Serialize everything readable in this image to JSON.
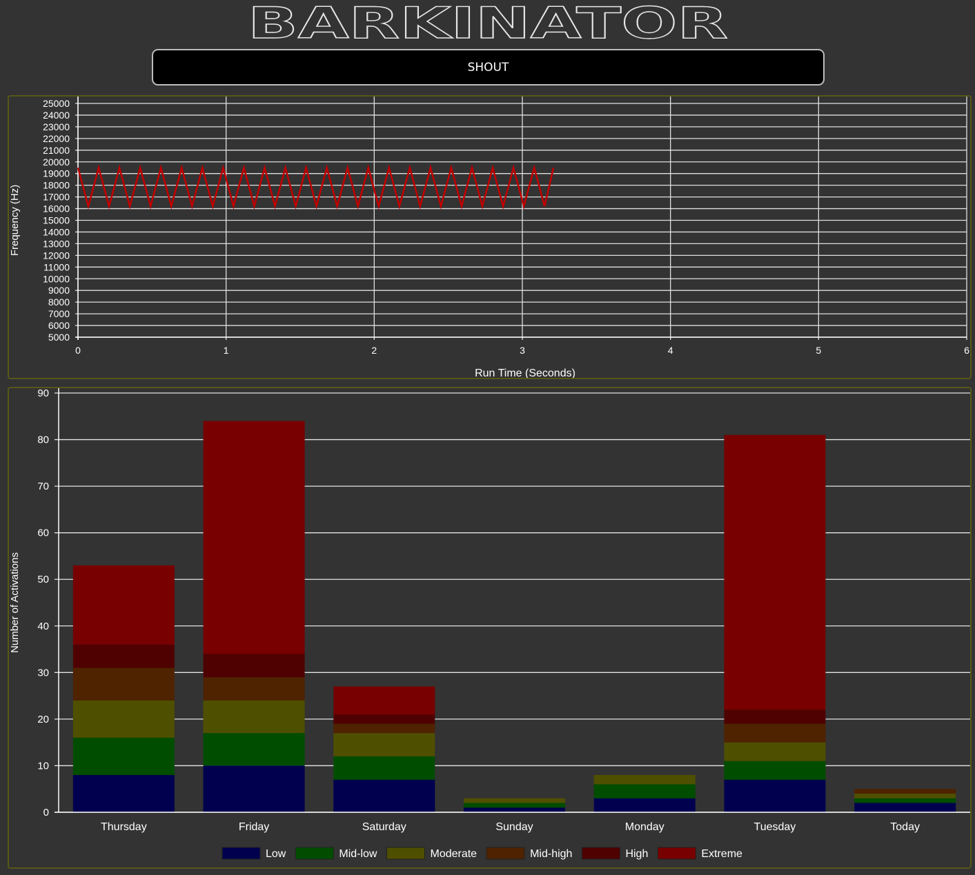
{
  "app": {
    "title": "BARKINATOR"
  },
  "controls": {
    "shout_label": "SHOUT"
  },
  "colors": {
    "background": "#333333",
    "panel_border": "#57571a",
    "waveform": "#c00000",
    "grid": "#ffffff"
  },
  "frequency_chart": {
    "type": "line",
    "ylabel": "Frequency (Hz)",
    "xlabel": "Run Time (Seconds)",
    "ylim": [
      5000,
      25000
    ],
    "yticks": [
      5000,
      6000,
      7000,
      8000,
      9000,
      10000,
      11000,
      12000,
      13000,
      14000,
      15000,
      16000,
      17000,
      18000,
      19000,
      20000,
      21000,
      22000,
      23000,
      24000,
      25000
    ],
    "xlim": [
      0,
      6
    ],
    "xticks": [
      0,
      1,
      2,
      3,
      4,
      5,
      6
    ],
    "grid": true,
    "series": [
      {
        "color": "#c00000",
        "x": [
          0,
          0.07,
          0.14,
          0.21,
          0.28,
          0.35,
          0.42,
          0.49,
          0.56,
          0.63,
          0.7,
          0.77,
          0.84,
          0.91,
          0.98,
          1.05,
          1.12,
          1.19,
          1.26,
          1.33,
          1.4,
          1.47,
          1.54,
          1.61,
          1.68,
          1.75,
          1.82,
          1.89,
          1.96,
          2.03,
          2.1,
          2.17,
          2.24,
          2.31,
          2.38,
          2.45,
          2.52,
          2.59,
          2.66,
          2.73,
          2.8,
          2.87,
          2.94,
          3.01,
          3.08,
          3.15,
          3.21
        ],
        "y": [
          19500,
          16200,
          19500,
          16200,
          19500,
          16200,
          19500,
          16200,
          19500,
          16200,
          19500,
          16200,
          19500,
          16200,
          19500,
          16200,
          19500,
          16200,
          19500,
          16200,
          19500,
          16200,
          19500,
          16200,
          19500,
          16200,
          19500,
          16200,
          19500,
          16200,
          19500,
          16200,
          19500,
          16200,
          19500,
          16200,
          19500,
          16200,
          19500,
          16200,
          19500,
          16200,
          19500,
          16200,
          19500,
          16200,
          19500
        ]
      }
    ]
  },
  "chart_data": {
    "type": "bar",
    "stacked": true,
    "ylabel": "Number of Activations",
    "xlabel": "",
    "ylim": [
      0,
      90
    ],
    "yticks": [
      0,
      10,
      20,
      30,
      40,
      50,
      60,
      70,
      80,
      90
    ],
    "grid": true,
    "legend_position": "bottom",
    "categories": [
      "Thursday",
      "Friday",
      "Saturday",
      "Sunday",
      "Monday",
      "Tuesday",
      "Today"
    ],
    "series": [
      {
        "name": "Low",
        "color": "#00004f",
        "values": [
          8,
          10,
          7,
          1,
          3,
          7,
          2
        ]
      },
      {
        "name": "Mid-low",
        "color": "#004d00",
        "values": [
          8,
          7,
          5,
          1,
          3,
          4,
          1
        ]
      },
      {
        "name": "Moderate",
        "color": "#4f4f00",
        "values": [
          8,
          7,
          5,
          1,
          2,
          4,
          1
        ]
      },
      {
        "name": "Mid-high",
        "color": "#4f2200",
        "values": [
          7,
          5,
          2,
          0,
          0,
          4,
          1
        ]
      },
      {
        "name": "High",
        "color": "#4f0000",
        "values": [
          5,
          5,
          2,
          0,
          0,
          3,
          0
        ]
      },
      {
        "name": "Extreme",
        "color": "#780000",
        "values": [
          17,
          50,
          6,
          0,
          0,
          59,
          0
        ]
      }
    ]
  }
}
